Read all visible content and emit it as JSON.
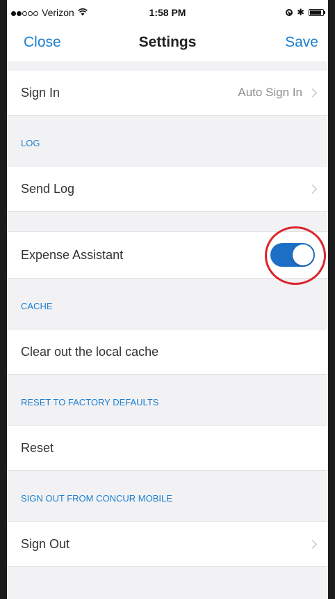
{
  "status_bar": {
    "carrier": "Verizon",
    "time": "1:58 PM",
    "signal_bars_filled": 2,
    "signal_bars_total": 5
  },
  "nav": {
    "close_label": "Close",
    "title": "Settings",
    "save_label": "Save"
  },
  "sign_in": {
    "label": "Sign In",
    "value": "Auto Sign In"
  },
  "log": {
    "header": "LOG",
    "send_log_label": "Send Log"
  },
  "expense_assistant": {
    "label": "Expense Assistant",
    "enabled": true
  },
  "cache": {
    "header": "CACHE",
    "clear_label": "Clear out the local cache"
  },
  "reset": {
    "header": "RESET TO FACTORY DEFAULTS",
    "label": "Reset"
  },
  "sign_out": {
    "header": "SIGN OUT FROM CONCUR MOBILE",
    "label": "Sign Out"
  },
  "colors": {
    "accent": "#1c7fd1",
    "toggle_on": "#1c6fc4",
    "highlight": "#d9262c",
    "background": "#f2f2f4"
  }
}
